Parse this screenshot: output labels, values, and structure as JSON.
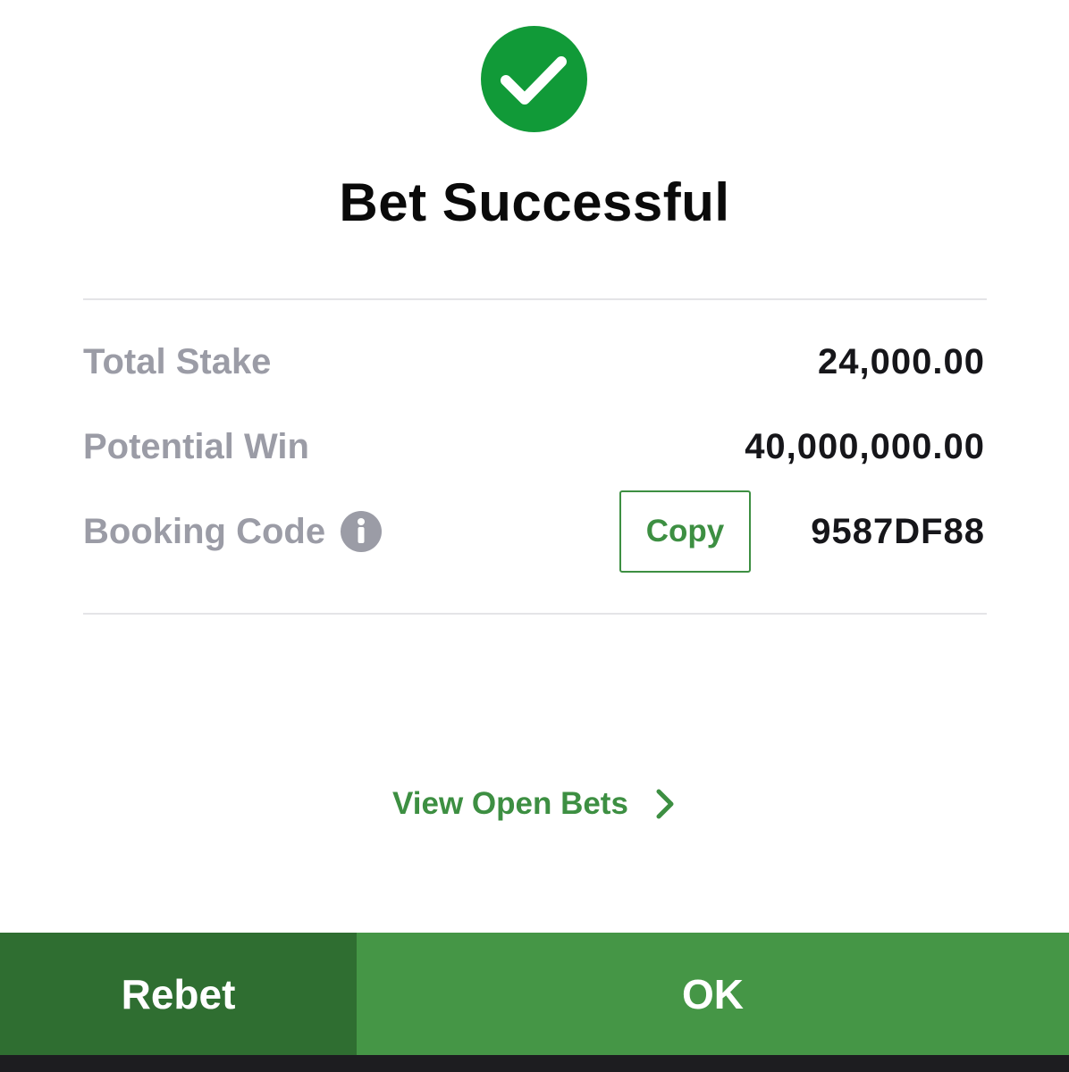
{
  "header": {
    "title": "Bet Successful"
  },
  "summary": {
    "total_stake_label": "Total Stake",
    "total_stake_value": "24,000.00",
    "potential_win_label": "Potential Win",
    "potential_win_value": "40,000,000.00",
    "booking_code_label": "Booking Code",
    "booking_code_value": "9587DF88",
    "copy_label": "Copy"
  },
  "links": {
    "view_open_bets": "View Open Bets"
  },
  "actions": {
    "rebet_label": "Rebet",
    "ok_label": "OK"
  },
  "colors": {
    "success_green": "#119a38",
    "accent_green": "#3d8f42",
    "rebet_bg": "#2f6e31",
    "ok_bg": "#459646",
    "label_gray": "#9b9ca6"
  },
  "icons": {
    "success": "checkmark-circle-icon",
    "info": "info-icon",
    "chevron": "chevron-right-icon"
  }
}
